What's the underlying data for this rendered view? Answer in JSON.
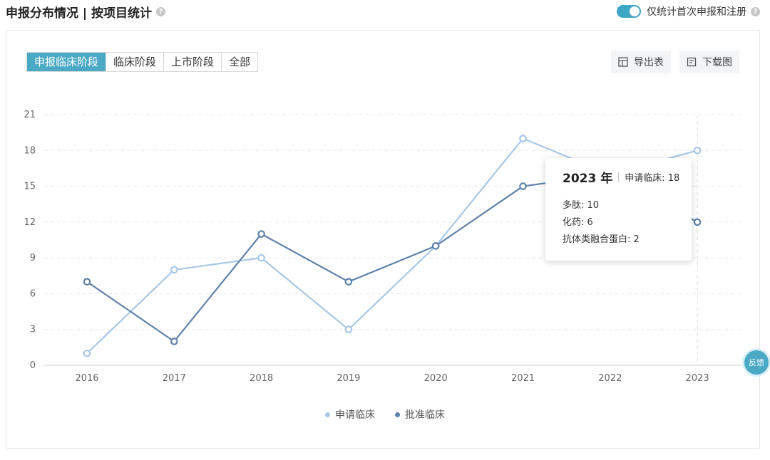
{
  "header": {
    "title": "申报分布情况 | 按项目统计",
    "help_glyph": "?",
    "toggle_label": "仅统计首次申报和注册",
    "toggle_on": true
  },
  "tabs": [
    {
      "label": "申报临床阶段",
      "active": true
    },
    {
      "label": "临床阶段",
      "active": false
    },
    {
      "label": "上市阶段",
      "active": false
    },
    {
      "label": "全部",
      "active": false
    }
  ],
  "toolbar": {
    "export_label": "导出表",
    "download_label": "下载图"
  },
  "tooltip": {
    "year": "2023 年",
    "series_line": "申请临床: 18",
    "details": [
      "多肽: 10",
      "化药: 6",
      "抗体类融合蛋白: 2"
    ]
  },
  "feedback_label": "反馈",
  "colors": {
    "accent": "#4aa9c4",
    "series_light": "#a9c8e6",
    "series_dark": "#5f82aa"
  },
  "chart_data": {
    "type": "line",
    "x": [
      "2016",
      "2017",
      "2018",
      "2019",
      "2020",
      "2021",
      "2022",
      "2023"
    ],
    "ylim": [
      0,
      21
    ],
    "yticks": [
      0,
      3,
      6,
      9,
      12,
      15,
      18,
      21
    ],
    "grid": true,
    "legend_position": "bottom-center",
    "series": [
      {
        "name": "申请临床",
        "values": [
          1,
          8,
          9,
          3,
          10,
          19,
          16,
          18
        ]
      },
      {
        "name": "批准临床",
        "values": [
          7,
          2,
          11,
          7,
          10,
          15,
          16,
          12
        ]
      }
    ],
    "highlight_x": "2023"
  }
}
